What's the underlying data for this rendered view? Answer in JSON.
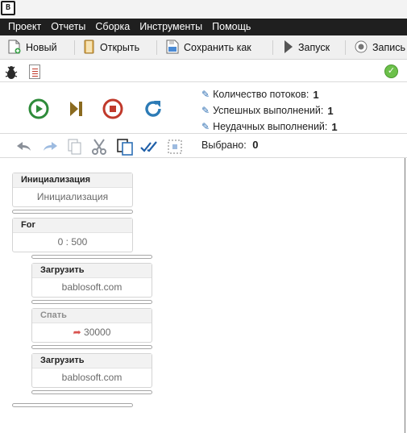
{
  "titlebar": {
    "app_icon_label": "B"
  },
  "menu": {
    "items": [
      "Проект",
      "Отчеты",
      "Сборка",
      "Инструменты",
      "Помощь"
    ]
  },
  "toolbar": {
    "new_label": "Новый",
    "open_label": "Открыть",
    "save_as_label": "Сохранить как",
    "run_label": "Запуск",
    "record_label": "Запись"
  },
  "stats": {
    "threads_label": "Количество потоков:",
    "threads_value": "1",
    "success_label": "Успешных выполнений:",
    "success_value": "1",
    "fail_label": "Неудачных выполнений:",
    "fail_value": "1"
  },
  "selection": {
    "label": "Выбрано:",
    "value": "0"
  },
  "blocks": [
    {
      "title": "Инициализация",
      "body": "Инициализация"
    },
    {
      "title": "For",
      "body": "0 : 500"
    },
    {
      "title": "Загрузить",
      "body": "bablosoft.com"
    },
    {
      "title": "Спать",
      "body": "30000"
    },
    {
      "title": "Загрузить",
      "body": "bablosoft.com"
    }
  ],
  "colors": {
    "play": "#2e8b3a",
    "stop": "#c0392b",
    "refresh": "#2c7bb6",
    "ok": "#6cc04a",
    "menubar": "#1f1f1f"
  }
}
